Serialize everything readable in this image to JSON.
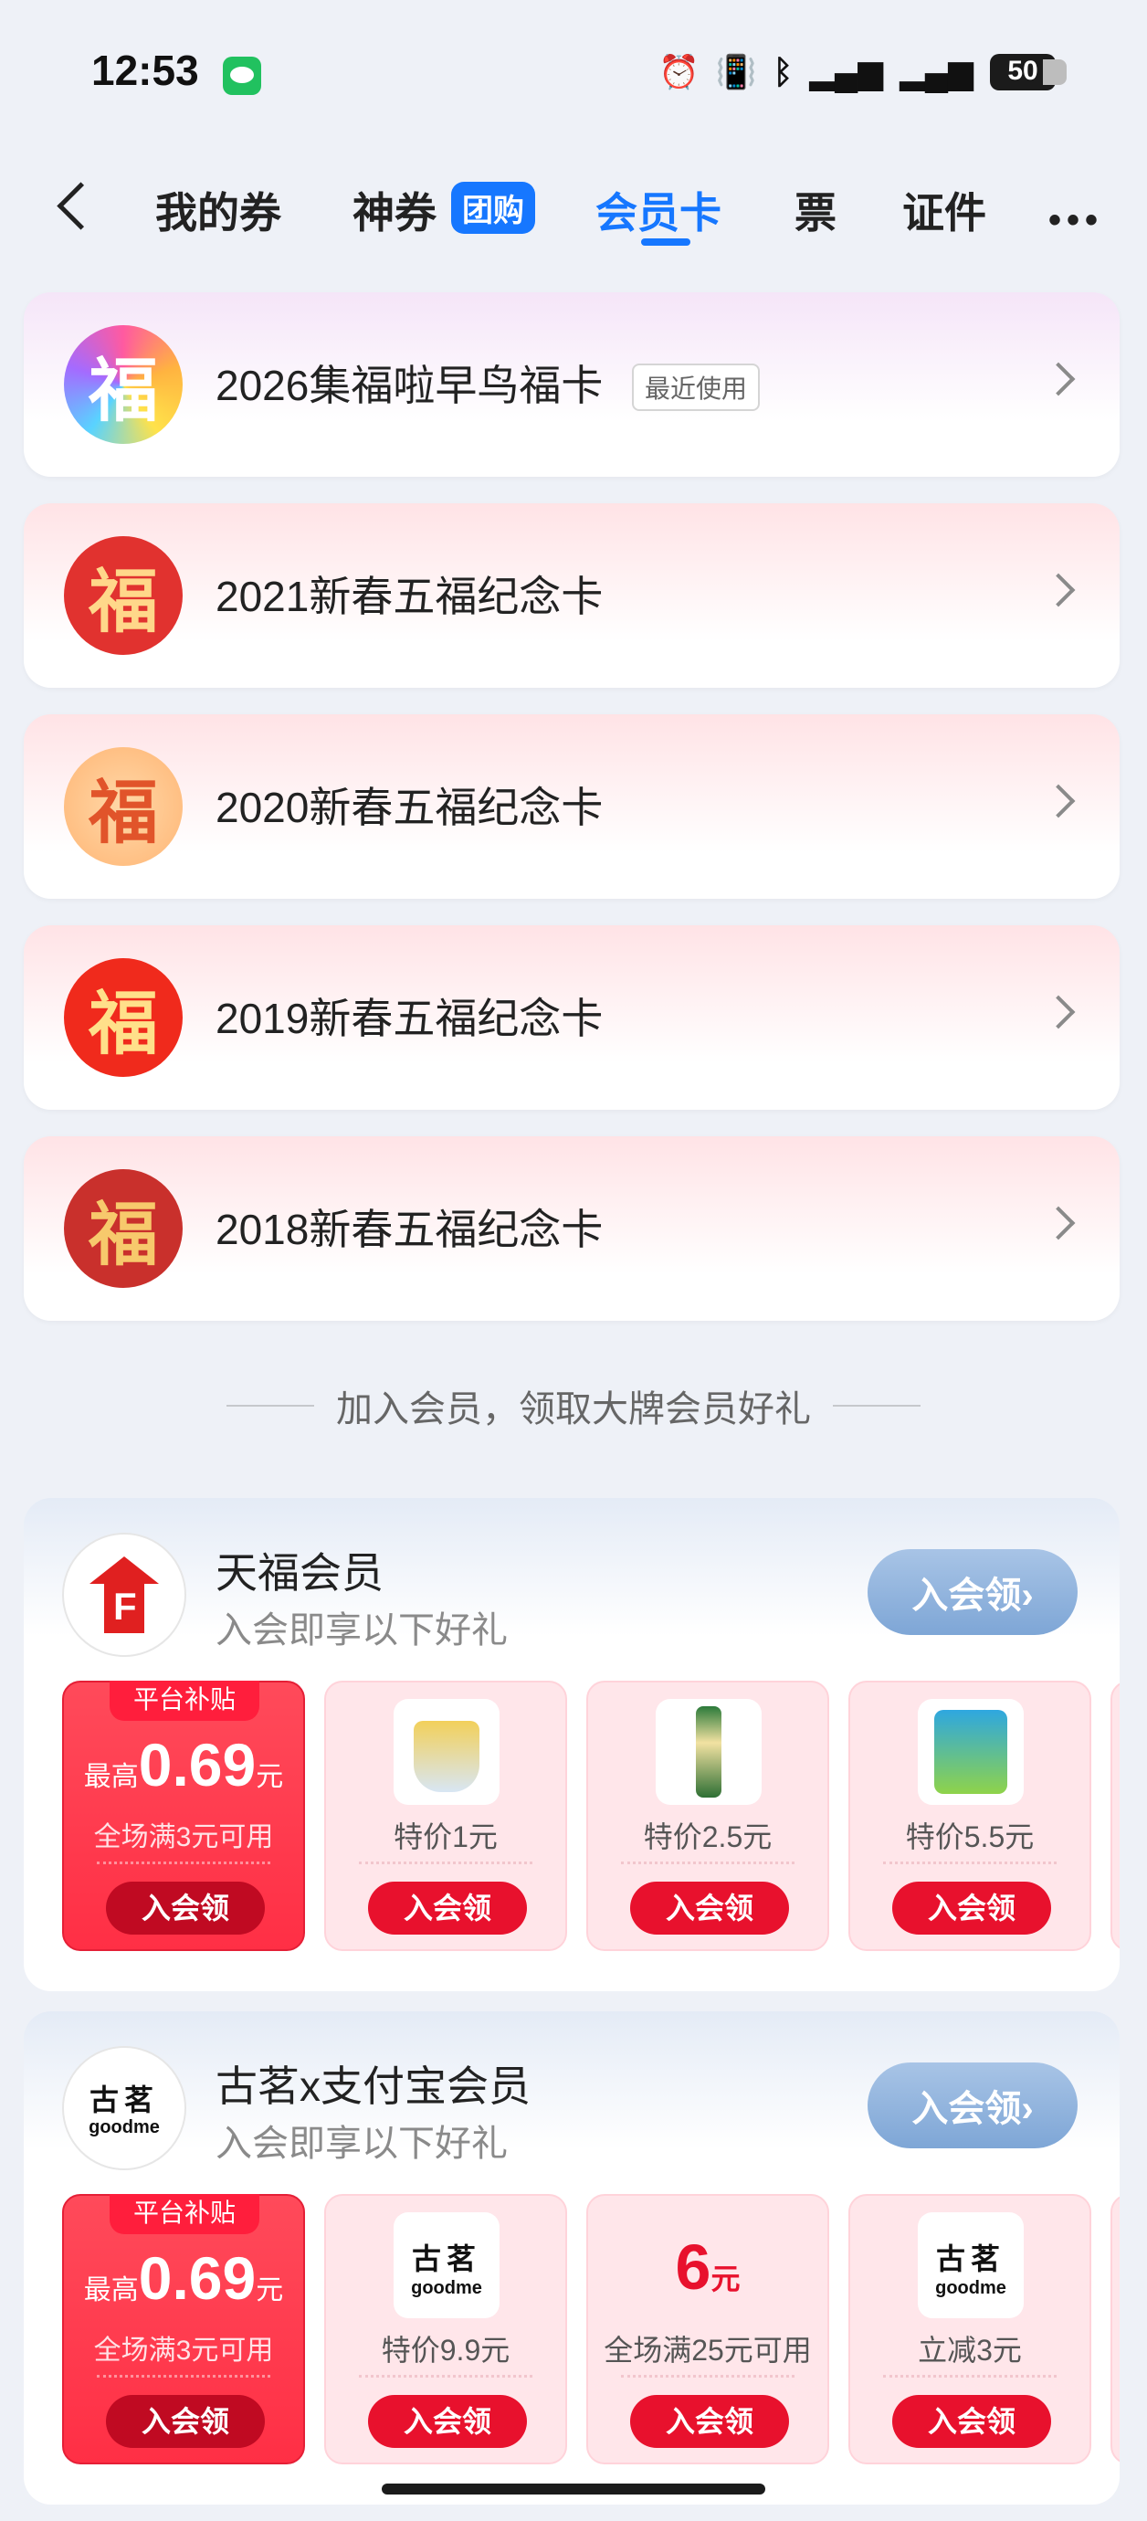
{
  "status_bar": {
    "time": "12:53",
    "battery": "50"
  },
  "tabs": {
    "items": [
      {
        "label": "我的券"
      },
      {
        "label": "神券"
      },
      {
        "label": "会员卡"
      },
      {
        "label": "票"
      },
      {
        "label": "证件"
      }
    ],
    "badge": "团购",
    "active": "会员卡"
  },
  "fu_cards": [
    {
      "icon_char": "福",
      "title": "2026集福啦早鸟福卡",
      "tag": "最近使用"
    },
    {
      "icon_char": "福",
      "title": "2021新春五福纪念卡"
    },
    {
      "icon_char": "福",
      "title": "2020新春五福纪念卡"
    },
    {
      "icon_char": "福",
      "title": "2019新春五福纪念卡"
    },
    {
      "icon_char": "福",
      "title": "2018新春五福纪念卡"
    }
  ],
  "section_title": "加入会员，领取大牌会员好礼",
  "members": [
    {
      "name": "天福会员",
      "subtitle": "入会即享以下好礼",
      "join_label": "入会领›",
      "logo_letter": "F",
      "coupons": [
        {
          "tag": "平台补贴",
          "prefix": "最高",
          "amount": "0.69",
          "unit": "元",
          "condition": "全场满3元可用",
          "button": "入会领"
        },
        {
          "label": "特价1元",
          "button": "入会领"
        },
        {
          "label": "特价2.5元",
          "button": "入会领"
        },
        {
          "label": "特价5.5元",
          "button": "入会领"
        }
      ]
    },
    {
      "name": "古茗x支付宝会员",
      "subtitle": "入会即享以下好礼",
      "join_label": "入会领›",
      "logo_cn": "古茗",
      "logo_en": "goodme",
      "coupons": [
        {
          "tag": "平台补贴",
          "prefix": "最高",
          "amount": "0.69",
          "unit": "元",
          "condition": "全场满3元可用",
          "button": "入会领"
        },
        {
          "label": "特价9.9元",
          "button": "入会领",
          "logo_cn": "古茗",
          "logo_en": "goodme"
        },
        {
          "amount": "6",
          "unit": "元",
          "label": "全场满25元可用",
          "button": "入会领"
        },
        {
          "label": "立减3元",
          "button": "入会领",
          "logo_cn": "古茗",
          "logo_en": "goodme"
        }
      ]
    }
  ],
  "colors": {
    "accent": "#1677ff",
    "coupon_red": "#e8112d"
  }
}
